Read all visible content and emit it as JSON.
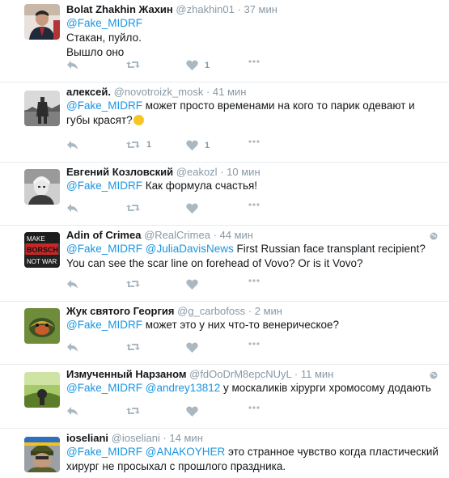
{
  "tweets": [
    {
      "name": "Bolat Zhakhin Жахин",
      "handle": "@zhakhin01",
      "dot": "·",
      "time": "37 мин",
      "mention": "@Fake_MIDRF",
      "text": "Стакан, пуйло.",
      "text2": "Вышло оно",
      "retweets": "",
      "likes": "1",
      "globe": false
    },
    {
      "name": "алексей.",
      "handle": "@novotroizk_mosk",
      "dot": "·",
      "time": "41 мин",
      "mention": "@Fake_MIDRF",
      "text": " может просто временами на кого то парик одевают и губы красят?",
      "emoji": "rolling-on-floor-laughing-emoji",
      "retweets": "1",
      "likes": "1",
      "globe": false
    },
    {
      "name": "Евгений Козловский",
      "handle": "@eakozl",
      "dot": "·",
      "time": "10 мин",
      "mention": "@Fake_MIDRF",
      "text": " Как формула счастья!",
      "retweets": "",
      "likes": "",
      "globe": false
    },
    {
      "name": "Adin of Crimea",
      "handle": "@RealCrimea",
      "dot": "·",
      "time": "44 мин",
      "mention": "@Fake_MIDRF",
      "mention2": "@JuliaDavisNews",
      "text": " First Russian face transplant recipient? You can see the scar line on forehead of Vovo? Or is it Vovo?",
      "avatar_text": [
        "MAKE",
        "BORSCH",
        "NOT WAR"
      ],
      "retweets": "",
      "likes": "",
      "globe": true
    },
    {
      "name": "Жук святого Георгия",
      "handle": "@g_carbofoss",
      "dot": "·",
      "time": "2 мин",
      "mention": "@Fake_MIDRF",
      "text": " может это у них что-то венерическое?",
      "retweets": "",
      "likes": "",
      "globe": false
    },
    {
      "name": "Измученный Нарзаном",
      "handle": "@fdOoDrM8epcNUyL",
      "dot": "·",
      "time": "11 мин",
      "mention": "@Fake_MIDRF",
      "mention2": "@andrey13812",
      "text": " у москаликів хірурги хромосому додають",
      "retweets": "",
      "likes": "",
      "globe": true
    },
    {
      "name": "ioseliani",
      "handle": "@ioseliani",
      "dot": "·",
      "time": "14 мин",
      "mention": "@Fake_MIDRF",
      "mention2": "@ANAKOYHER",
      "text": " это странное чувство когда пластический хирург не просыхал с прошлого праздника.",
      "retweets": "",
      "likes": "",
      "globe": false
    }
  ],
  "colors": {
    "link": "#1b95e0",
    "muted": "#8899a6",
    "icon": "#aab8c2",
    "like_active": "#8899a6"
  },
  "icons": {
    "reply": "reply-icon",
    "retweet": "retweet-icon",
    "like": "heart-icon",
    "globe": "globe-icon"
  }
}
